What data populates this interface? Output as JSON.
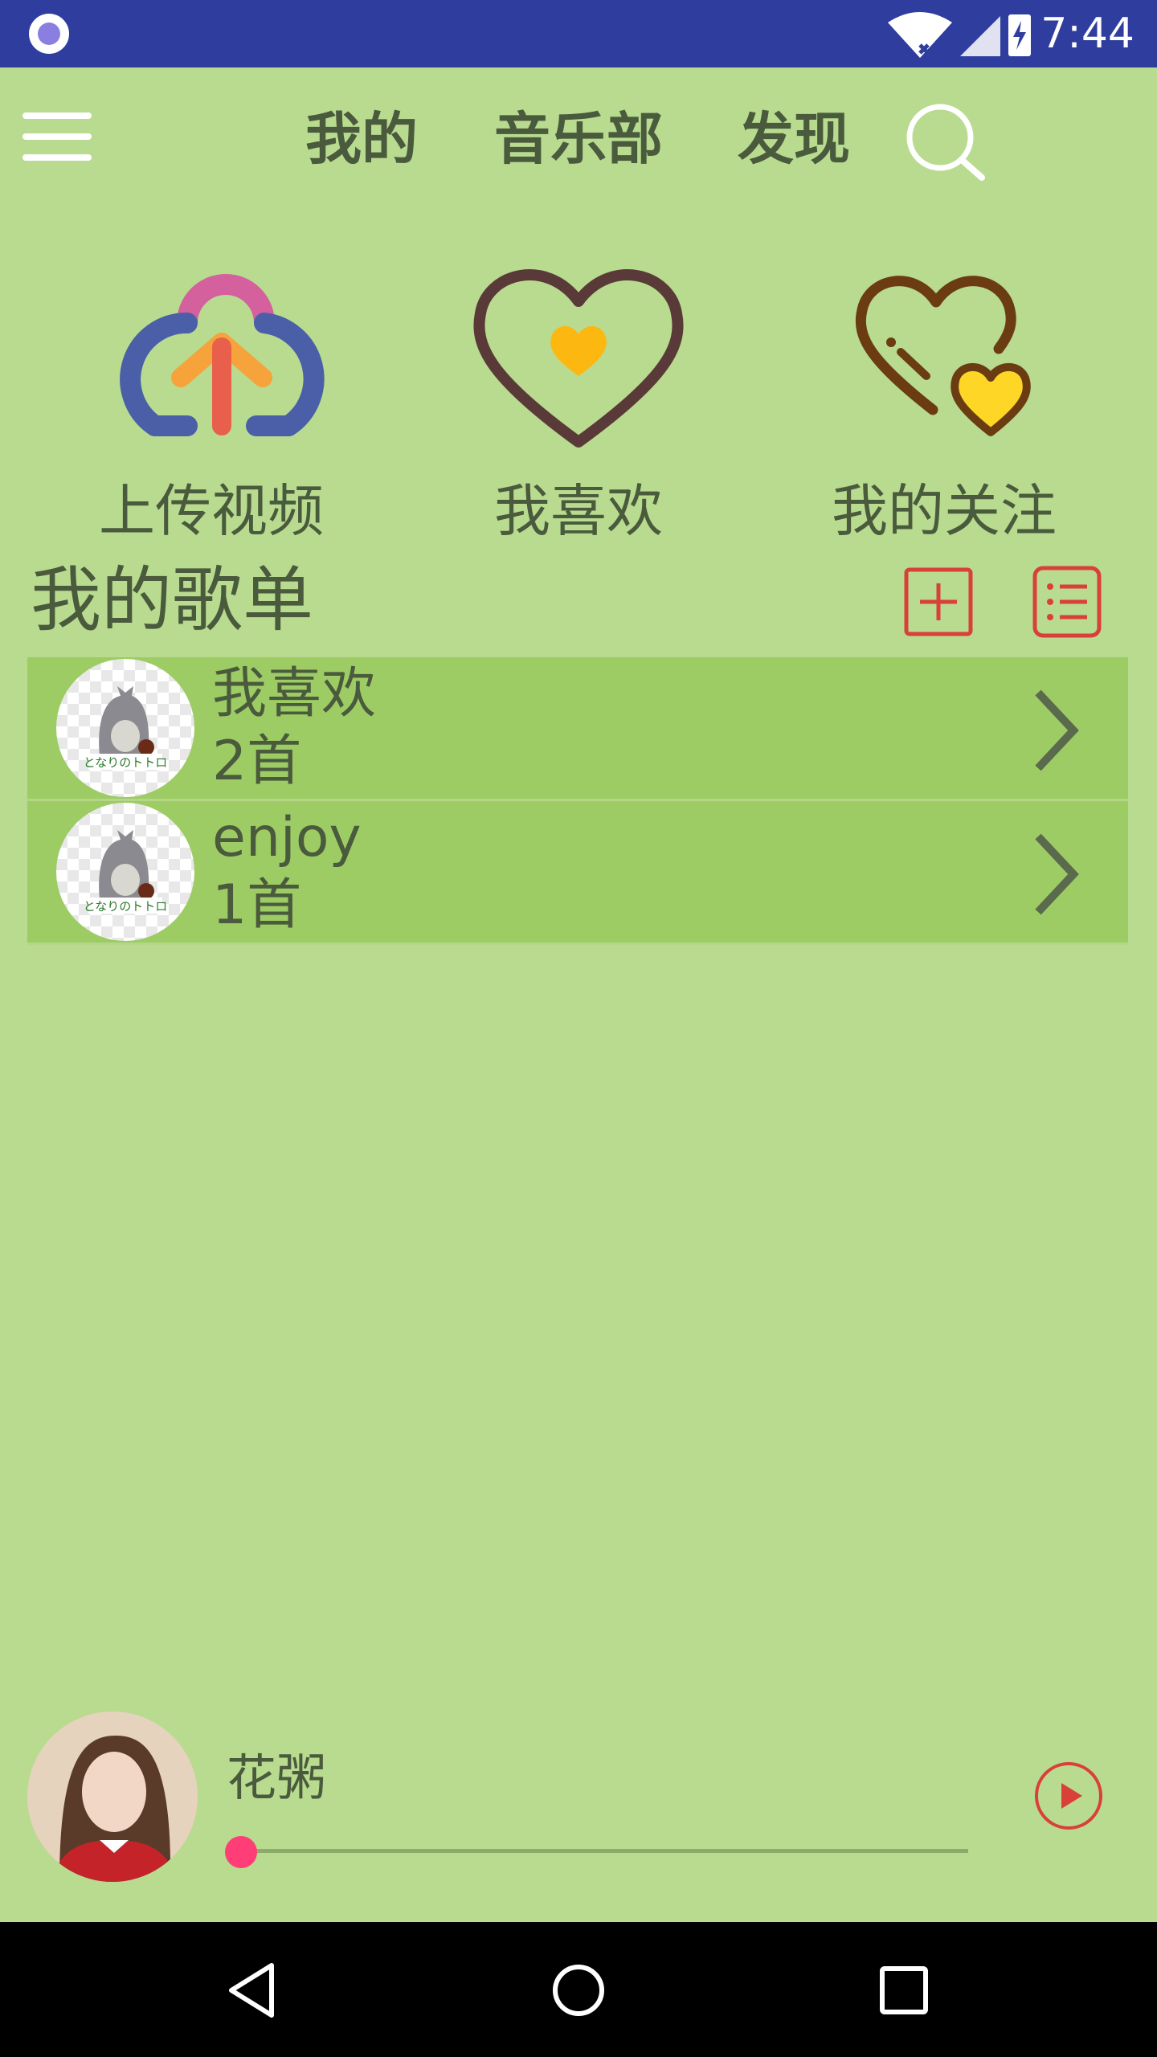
{
  "status_bar": {
    "time": "7:44"
  },
  "nav": {
    "tabs": [
      {
        "label": "我的"
      },
      {
        "label": "音乐部"
      },
      {
        "label": "发现"
      }
    ]
  },
  "shortcuts": [
    {
      "label": "上传视频",
      "icon": "cloud-upload-icon"
    },
    {
      "label": "我喜欢",
      "icon": "heart-icon"
    },
    {
      "label": "我的关注",
      "icon": "double-heart-icon"
    }
  ],
  "playlists": {
    "title": "我的歌单",
    "items": [
      {
        "name": "我喜欢",
        "count": "2首"
      },
      {
        "name": "enjoy",
        "count": "1首"
      }
    ]
  },
  "player": {
    "song": "花粥",
    "progress": 0.0,
    "accent_color": "#ff3d77"
  },
  "colors": {
    "background": "#b8db90",
    "status_bar": "#2f3e9e",
    "row": "#9dcc65",
    "red_icon": "#d9403a"
  }
}
